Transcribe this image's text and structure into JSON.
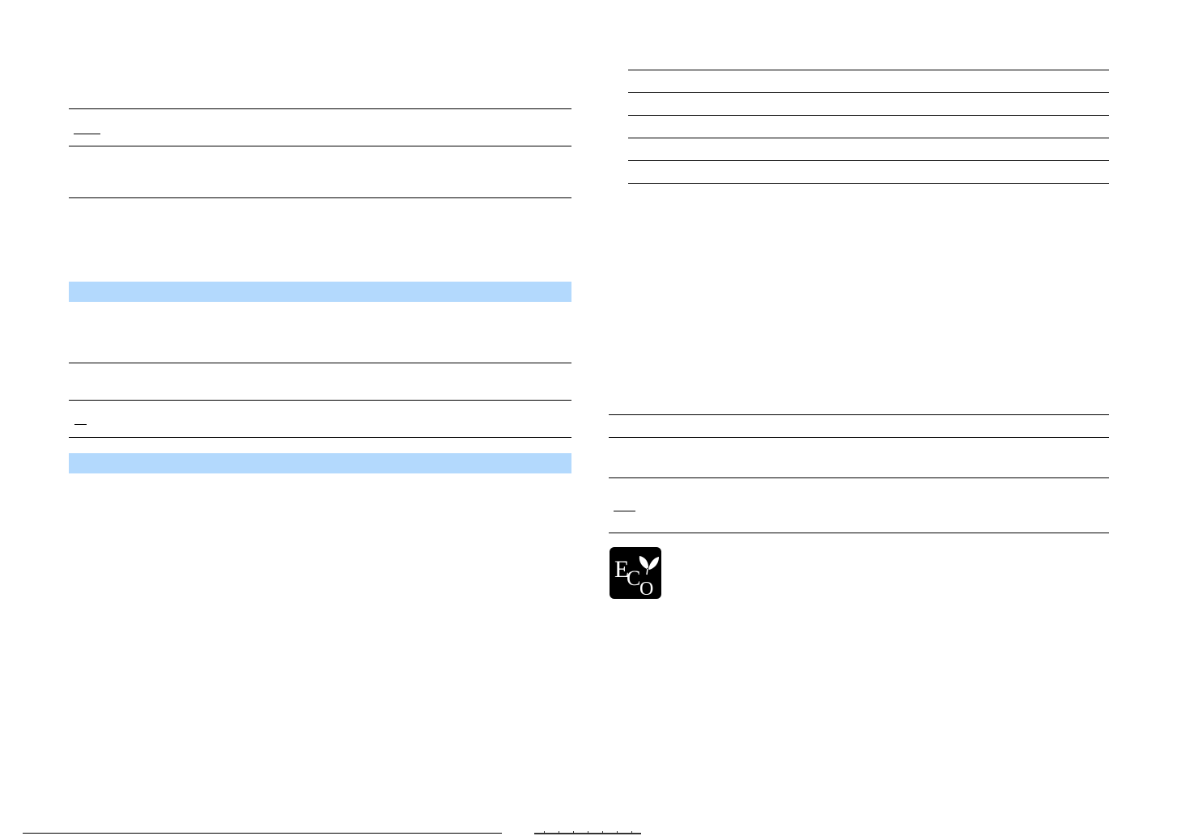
{
  "page": {
    "left_column": {
      "tables": [
        {
          "rows": 3
        },
        {
          "rows": 2
        }
      ],
      "section_bands": 2
    },
    "right_column": {
      "tables": [
        {
          "rows": 5
        },
        {
          "rows": 3
        }
      ]
    },
    "eco_mark": {
      "icon": "eco-leaf-icon",
      "letters": [
        "E",
        "C",
        "O"
      ],
      "colors": {
        "background": "#000000",
        "foreground": "#ffffff"
      }
    },
    "colors": {
      "band": "#b3d9fd",
      "rule": "#000000"
    }
  }
}
